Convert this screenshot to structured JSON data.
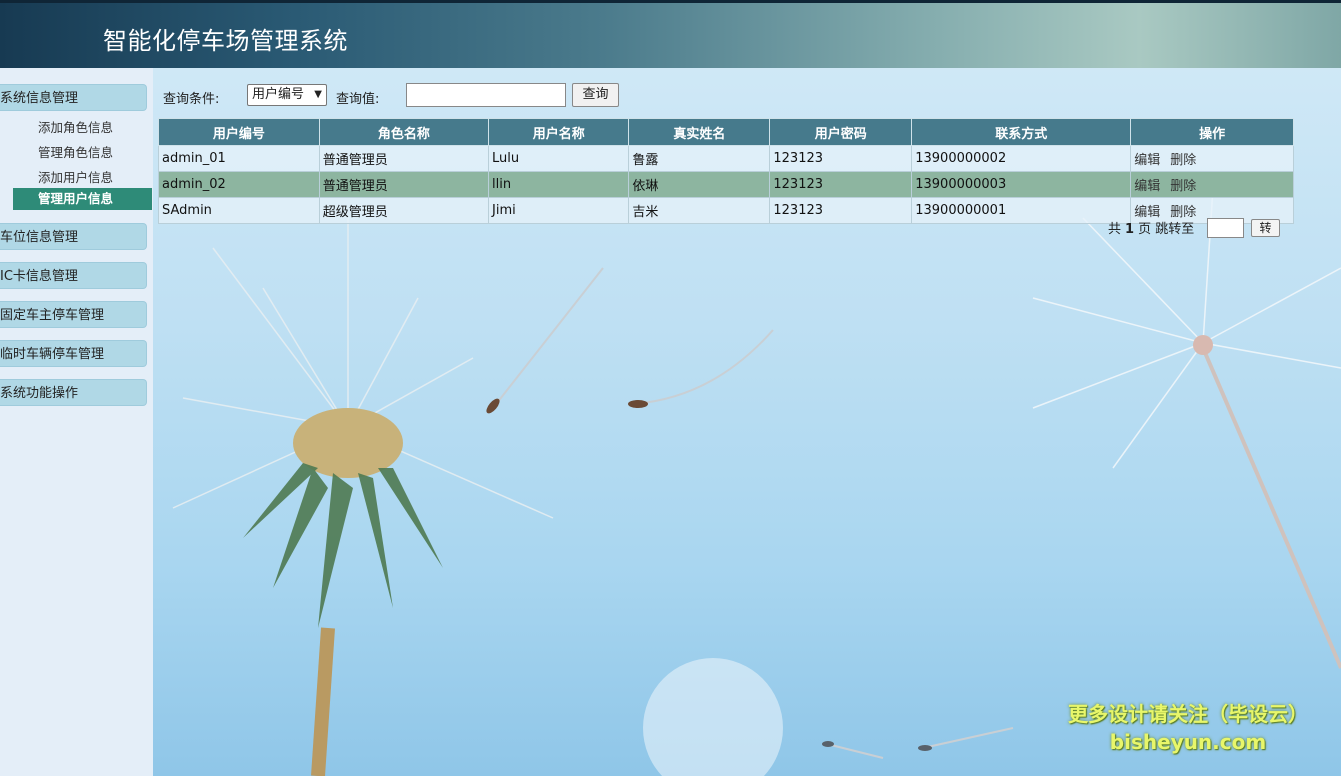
{
  "header": {
    "title": "智能化停车场管理系统"
  },
  "sidebar": {
    "groups": [
      {
        "label": "系统信息管理"
      },
      {
        "label": "车位信息管理"
      },
      {
        "label": "IC卡信息管理"
      },
      {
        "label": "固定车主停车管理"
      },
      {
        "label": "临时车辆停车管理"
      },
      {
        "label": "系统功能操作"
      }
    ],
    "sub_items": [
      {
        "label": "添加角色信息"
      },
      {
        "label": "管理角色信息"
      },
      {
        "label": "添加用户信息"
      },
      {
        "label": "管理用户信息"
      }
    ]
  },
  "search": {
    "condition_label": "查询条件:",
    "condition_value": "用户编号",
    "value_label": "查询值:",
    "input_value": "",
    "button": "查询"
  },
  "table": {
    "headers": [
      "用户编号",
      "角色名称",
      "用户名称",
      "真实姓名",
      "用户密码",
      "联系方式",
      "操作"
    ],
    "rows": [
      {
        "id": "admin_01",
        "role": "普通管理员",
        "username": "Lulu",
        "realname": "鲁露",
        "password": "123123",
        "contact": "13900000002",
        "edit": "编辑",
        "delete": "删除"
      },
      {
        "id": "admin_02",
        "role": "普通管理员",
        "username": "llin",
        "realname": "依琳",
        "password": "123123",
        "contact": "13900000003",
        "edit": "编辑",
        "delete": "删除"
      },
      {
        "id": "SAdmin",
        "role": "超级管理员",
        "username": "Jimi",
        "realname": "吉米",
        "password": "123123",
        "contact": "13900000001",
        "edit": "编辑",
        "delete": "删除"
      }
    ]
  },
  "pager": {
    "prefix": "共",
    "pages": "1",
    "suffix": "页 跳转至",
    "goto_value": "",
    "button": "转"
  },
  "watermark": {
    "line1": "更多设计请关注（毕设云）",
    "line2": "bisheyun.com"
  }
}
